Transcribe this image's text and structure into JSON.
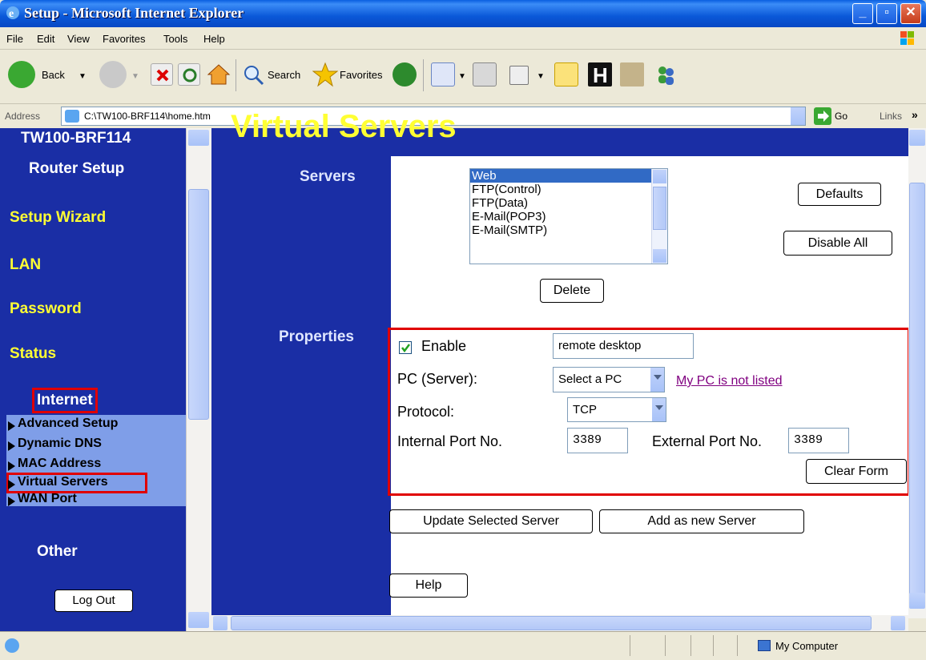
{
  "window": {
    "title": "Setup - Microsoft Internet Explorer"
  },
  "menu": [
    "File",
    "Edit",
    "View",
    "Favorites",
    "Tools",
    "Help"
  ],
  "toolbar": {
    "back": "Back",
    "search": "Search",
    "favorites": "Favorites"
  },
  "address": {
    "label": "Address",
    "value": "C:\\TW100-BRF114\\home.htm",
    "go": "Go",
    "links": "Links"
  },
  "sidebar": {
    "model": "TW100-BRF114",
    "subtitle": "Router Setup",
    "items": [
      "Setup Wizard",
      "LAN",
      "Password",
      "Status"
    ],
    "internet": "Internet",
    "subitems": [
      "Advanced Setup",
      "Dynamic DNS",
      "MAC Address",
      "Virtual Servers",
      "WAN Port"
    ],
    "other": "Other",
    "logout": "Log Out"
  },
  "main": {
    "page_title": "Virtual Servers",
    "servers_label": "Servers",
    "servers_list": [
      "Web",
      "FTP(Control)",
      "FTP(Data)",
      "E-Mail(POP3)",
      "E-Mail(SMTP)"
    ],
    "defaults_btn": "Defaults",
    "disable_all_btn": "Disable All",
    "delete_btn": "Delete",
    "properties_label": "Properties",
    "enable_label": "Enable",
    "enable_checked": true,
    "name_value": "remote desktop",
    "pc_label": "PC (Server):",
    "pc_select": "Select a PC",
    "pc_link": "My PC is not listed",
    "protocol_label": "Protocol:",
    "protocol_value": "TCP",
    "internal_port_label": "Internal Port No.",
    "internal_port_value": "3389",
    "external_port_label": "External Port No.",
    "external_port_value": "3389",
    "clear_form_btn": "Clear Form",
    "update_btn": "Update Selected Server",
    "add_btn": "Add as new Server",
    "help_btn": "Help"
  },
  "status": {
    "zone": "My Computer"
  },
  "colors": {
    "frame_bg": "#1a2ea5",
    "nav_yellow": "#ffff33",
    "highlight_red": "#e00000"
  }
}
